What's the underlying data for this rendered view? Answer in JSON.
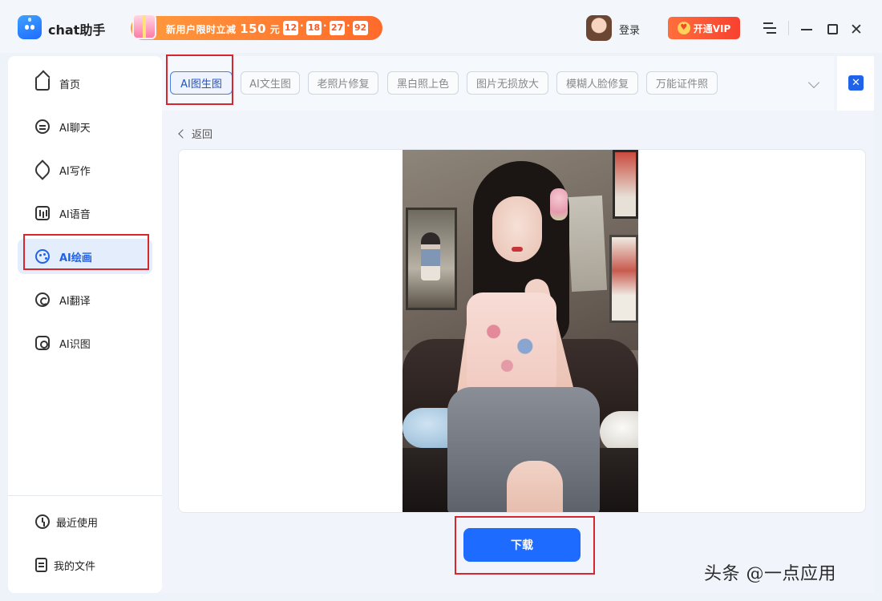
{
  "app": {
    "name": "chat助手",
    "login_label": "登录",
    "vip_label": "开通VIP"
  },
  "promo": {
    "text_prefix": "新用户限时立减",
    "amount": "150",
    "unit": "元",
    "countdown": [
      "12",
      "18",
      "27",
      "92"
    ]
  },
  "sidebar": {
    "items": [
      {
        "label": "首页",
        "icon": "home-icon"
      },
      {
        "label": "AI聊天",
        "icon": "chat-bubble-icon"
      },
      {
        "label": "AI写作",
        "icon": "feather-pen-icon"
      },
      {
        "label": "AI语音",
        "icon": "voice-wave-icon"
      },
      {
        "label": "AI绘画",
        "icon": "palette-icon",
        "active": true
      },
      {
        "label": "AI翻译",
        "icon": "translate-icon"
      },
      {
        "label": "AI识图",
        "icon": "image-scan-icon"
      }
    ],
    "bottom": [
      {
        "label": "最近使用",
        "icon": "history-clock-icon"
      },
      {
        "label": "我的文件",
        "icon": "file-icon"
      }
    ]
  },
  "tabs": [
    {
      "label": "AI图生图",
      "active": true
    },
    {
      "label": "AI文生图"
    },
    {
      "label": "老照片修复"
    },
    {
      "label": "黑白照上色"
    },
    {
      "label": "图片无损放大"
    },
    {
      "label": "模糊人脸修复"
    },
    {
      "label": "万能证件照"
    }
  ],
  "main": {
    "back_label": "返回",
    "download_label": "下载"
  },
  "colors": {
    "accent": "#1e6bff",
    "highlight_box": "#d8262d",
    "vip_gradient_start": "#ff6f3c",
    "promo_gradient_start": "#ff9b3d"
  },
  "watermark": "头条 @一点应用"
}
